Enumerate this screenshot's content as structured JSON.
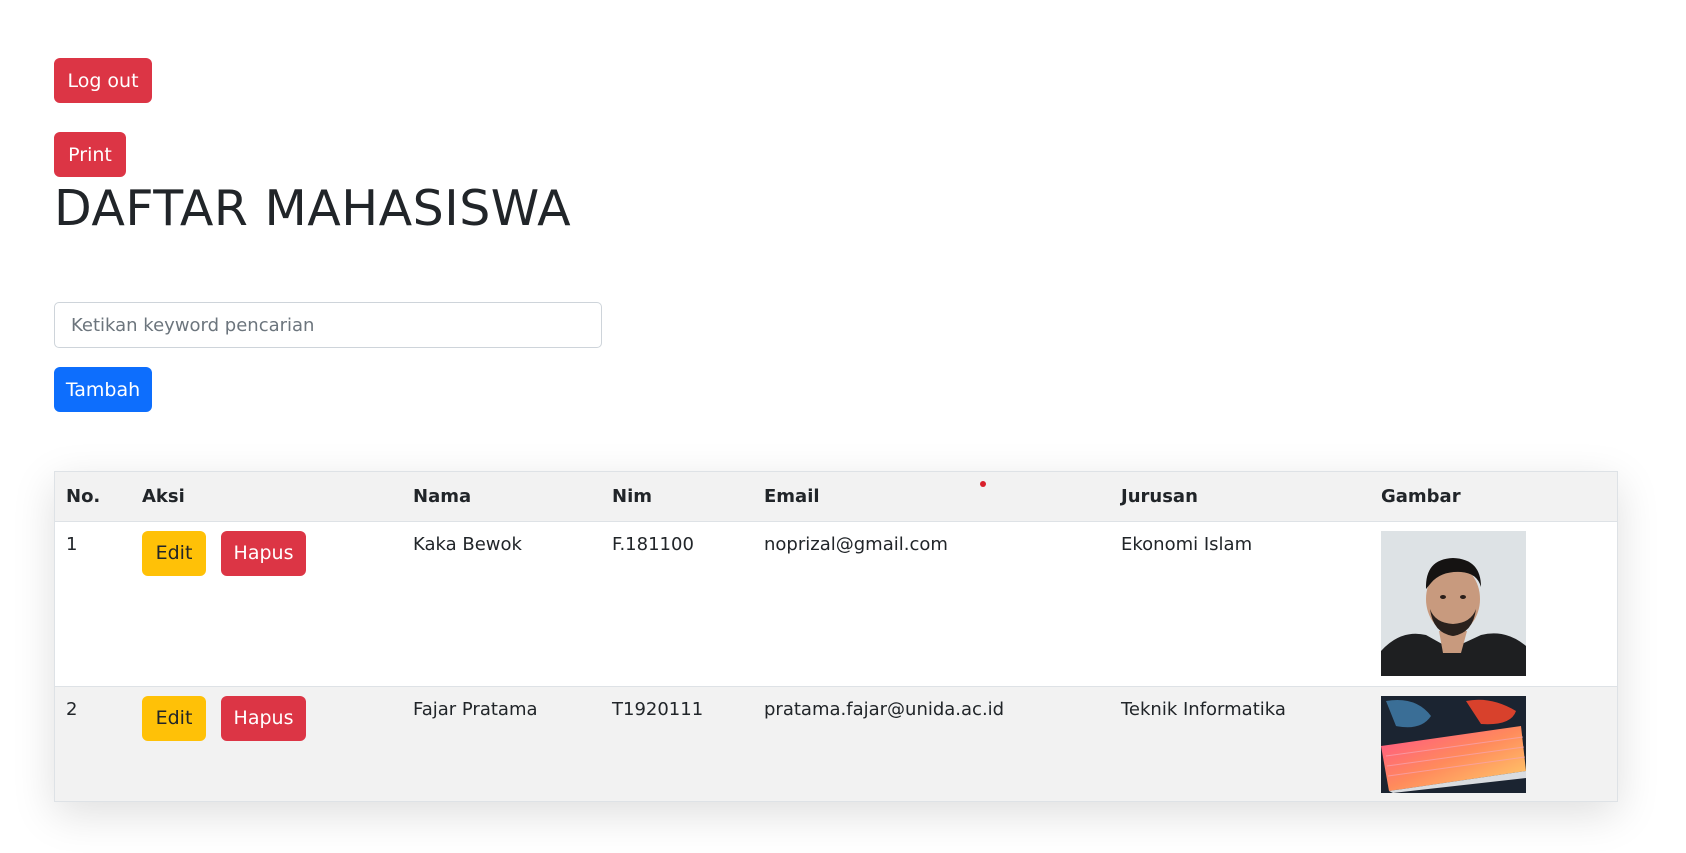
{
  "buttons": {
    "logout": "Log out",
    "print": "Print",
    "tambah": "Tambah"
  },
  "title": "DAFTAR MAHASISWA",
  "search": {
    "placeholder": "Ketikan keyword pencarian",
    "value": ""
  },
  "table": {
    "headers": [
      "No.",
      "Aksi",
      "Nama",
      "Nim",
      "Email",
      "Jurusan",
      "Gambar"
    ],
    "rows": [
      {
        "no": "1",
        "edit_label": "Edit",
        "hapus_label": "Hapus",
        "nama": "Kaka Bewok",
        "nim": "F.181100",
        "email": "noprizal@gmail.com",
        "jurusan": "Ekonomi Islam",
        "gambar": "portrait-photo"
      },
      {
        "no": "2",
        "edit_label": "Edit",
        "hapus_label": "Hapus",
        "nama": "Fajar Pratama",
        "nim": "T1920111",
        "email": "pratama.fajar@unida.ac.id",
        "jurusan": "Teknik Informatika",
        "gambar": "keyboard-photo"
      }
    ]
  },
  "colors": {
    "danger": "#dc3545",
    "primary": "#0d6efd",
    "warning": "#ffc107",
    "header_bg": "#f2f2f2"
  }
}
